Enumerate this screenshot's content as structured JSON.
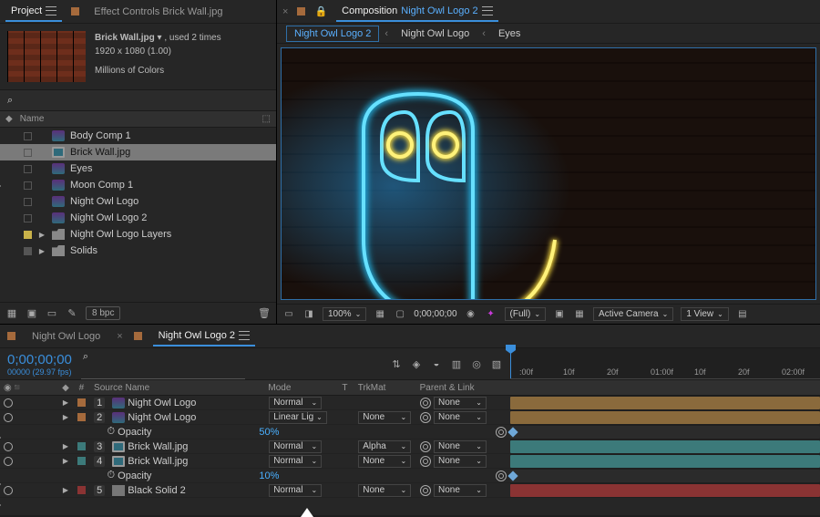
{
  "project_panel": {
    "tabs": {
      "project": "Project",
      "effect_controls": "Effect Controls Brick Wall.jpg"
    },
    "meta": {
      "name": "Brick Wall.jpg",
      "used": ", used 2 times",
      "dims": "1920 x 1080 (1.00)",
      "colors": "Millions of Colors"
    },
    "search_placeholder": "",
    "header": "Name",
    "rows": [
      {
        "type": "comp",
        "label": "Body Comp 1"
      },
      {
        "type": "img",
        "label": "Brick Wall.jpg",
        "sel": true
      },
      {
        "type": "comp",
        "label": "Eyes"
      },
      {
        "type": "comp",
        "label": "Moon Comp 1"
      },
      {
        "type": "comp",
        "label": "Night Owl Logo"
      },
      {
        "type": "comp",
        "label": "Night Owl Logo 2"
      },
      {
        "type": "folder",
        "label": "Night Owl Logo Layers",
        "swatch": "yellow"
      },
      {
        "type": "folder",
        "label": "Solids",
        "swatch": "grey"
      }
    ],
    "bpc": "8 bpc"
  },
  "comp_panel": {
    "tab": "Composition",
    "active_name": "Night Owl Logo 2",
    "crumbs": [
      "Night Owl Logo 2",
      "Night Owl Logo",
      "Eyes"
    ],
    "footer": {
      "zoom": "100%",
      "time": "0;00;00;00",
      "res": "(Full)",
      "camera": "Active Camera",
      "views": "1 View"
    }
  },
  "timeline": {
    "tabs": [
      "Night Owl Logo",
      "Night Owl Logo 2"
    ],
    "active_tab": 1,
    "timecode": "0;00;00;00",
    "fps": "00000 (29.97 fps)",
    "columns": {
      "src": "Source Name",
      "mode": "Mode",
      "trk": "TrkMat",
      "parent": "Parent & Link",
      "num": "#",
      "t": "T"
    },
    "ruler": [
      ":00f",
      "10f",
      "20f",
      "01:00f",
      "10f",
      "20f",
      "02:00f"
    ],
    "layers": [
      {
        "num": "1",
        "name": "Night Owl Logo",
        "mode": "Normal",
        "trk": "",
        "parent": "None",
        "sw": "orange",
        "icon": "comp",
        "bar": "#8a6a3c"
      },
      {
        "num": "2",
        "name": "Night Owl Logo",
        "mode": "Linear Lig",
        "trk": "None",
        "parent": "None",
        "sw": "orange",
        "icon": "comp",
        "bar": "#8a6a3c",
        "prop": {
          "name": "Opacity",
          "val": "50%"
        }
      },
      {
        "num": "3",
        "name": "Brick Wall.jpg",
        "mode": "Normal",
        "trk": "Alpha",
        "parent": "None",
        "sw": "teal",
        "icon": "img",
        "bar": "#3c7a7a"
      },
      {
        "num": "4",
        "name": "Brick Wall.jpg",
        "mode": "Normal",
        "trk": "None",
        "parent": "None",
        "sw": "teal",
        "icon": "img",
        "bar": "#3c7a7a",
        "prop": {
          "name": "Opacity",
          "val": "10%"
        }
      },
      {
        "num": "5",
        "name": "Black Solid 2",
        "mode": "Normal",
        "trk": "None",
        "parent": "None",
        "sw": "red",
        "icon": "solid",
        "bar": "#8a3333"
      }
    ]
  }
}
